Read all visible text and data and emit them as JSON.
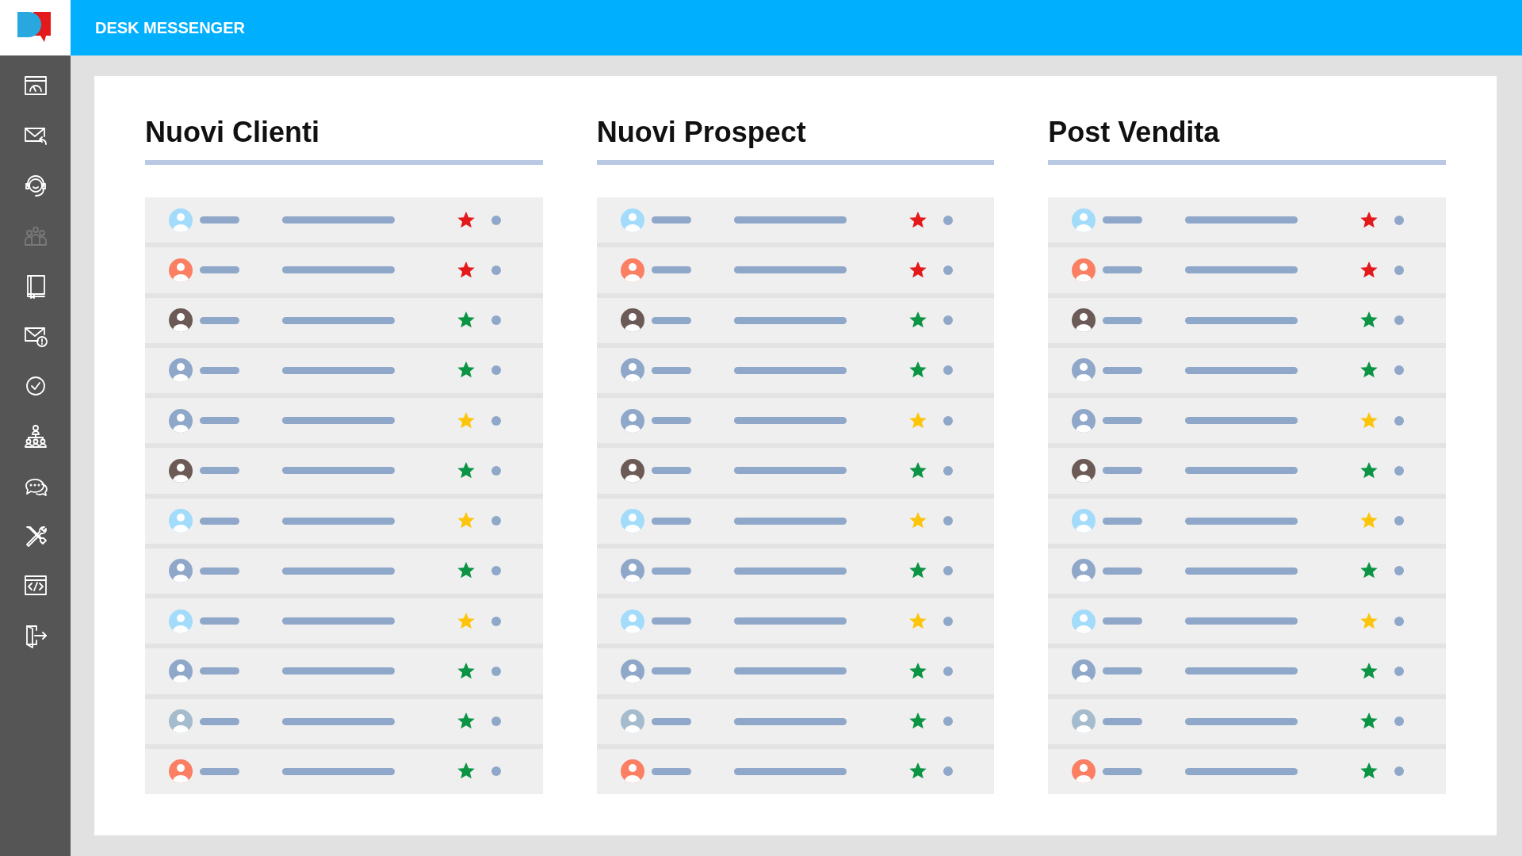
{
  "header": {
    "title": "DESK MESSENGER"
  },
  "sidebar": {
    "items": [
      {
        "kind": "dashboard",
        "disabled": false
      },
      {
        "kind": "mail-reply",
        "disabled": false
      },
      {
        "kind": "support",
        "disabled": false
      },
      {
        "kind": "team",
        "disabled": true
      },
      {
        "kind": "book",
        "disabled": false
      },
      {
        "kind": "mail-alert",
        "disabled": false
      },
      {
        "kind": "check",
        "disabled": false
      },
      {
        "kind": "hierarchy",
        "disabled": false
      },
      {
        "kind": "chat",
        "disabled": false
      },
      {
        "kind": "tools",
        "disabled": false
      },
      {
        "kind": "code",
        "disabled": false
      },
      {
        "kind": "exit",
        "disabled": false
      }
    ]
  },
  "columns": [
    {
      "title": "Nuovi Clienti",
      "rows": [
        {
          "avatar": {
            "color": "#a3dbfb"
          },
          "star": {
            "color": "#e3191b"
          }
        },
        {
          "avatar": {
            "color": "#fb7f62"
          },
          "star": {
            "color": "#e3191b"
          }
        },
        {
          "avatar": {
            "color": "#6b5a55"
          },
          "star": {
            "color": "#0b9444"
          }
        },
        {
          "avatar": {
            "color": "#8fa7c9"
          },
          "star": {
            "color": "#0b9444"
          }
        },
        {
          "avatar": {
            "color": "#8fa7c9"
          },
          "star": {
            "color": "#fcc50c"
          }
        },
        {
          "avatar": {
            "color": "#6b5a55"
          },
          "star": {
            "color": "#0b9444"
          }
        },
        {
          "avatar": {
            "color": "#a3dbfb"
          },
          "star": {
            "color": "#fcc50c"
          }
        },
        {
          "avatar": {
            "color": "#8fa7c9"
          },
          "star": {
            "color": "#0b9444"
          }
        },
        {
          "avatar": {
            "color": "#a3dbfb"
          },
          "star": {
            "color": "#fcc50c"
          }
        },
        {
          "avatar": {
            "color": "#8fa7c9"
          },
          "star": {
            "color": "#0b9444"
          }
        },
        {
          "avatar": {
            "color": "#a4bccd"
          },
          "star": {
            "color": "#0b9444"
          }
        },
        {
          "avatar": {
            "color": "#fb7f62"
          },
          "star": {
            "color": "#0b9444"
          }
        }
      ]
    },
    {
      "title": "Nuovi Prospect",
      "rows": [
        {
          "avatar": {
            "color": "#a3dbfb"
          },
          "star": {
            "color": "#e3191b"
          }
        },
        {
          "avatar": {
            "color": "#fb7f62"
          },
          "star": {
            "color": "#e3191b"
          }
        },
        {
          "avatar": {
            "color": "#6b5a55"
          },
          "star": {
            "color": "#0b9444"
          }
        },
        {
          "avatar": {
            "color": "#8fa7c9"
          },
          "star": {
            "color": "#0b9444"
          }
        },
        {
          "avatar": {
            "color": "#8fa7c9"
          },
          "star": {
            "color": "#fcc50c"
          }
        },
        {
          "avatar": {
            "color": "#6b5a55"
          },
          "star": {
            "color": "#0b9444"
          }
        },
        {
          "avatar": {
            "color": "#a3dbfb"
          },
          "star": {
            "color": "#fcc50c"
          }
        },
        {
          "avatar": {
            "color": "#8fa7c9"
          },
          "star": {
            "color": "#0b9444"
          }
        },
        {
          "avatar": {
            "color": "#a3dbfb"
          },
          "star": {
            "color": "#fcc50c"
          }
        },
        {
          "avatar": {
            "color": "#8fa7c9"
          },
          "star": {
            "color": "#0b9444"
          }
        },
        {
          "avatar": {
            "color": "#a4bccd"
          },
          "star": {
            "color": "#0b9444"
          }
        },
        {
          "avatar": {
            "color": "#fb7f62"
          },
          "star": {
            "color": "#0b9444"
          }
        }
      ]
    },
    {
      "title": "Post Vendita",
      "rows": [
        {
          "avatar": {
            "color": "#a3dbfb"
          },
          "star": {
            "color": "#e3191b"
          }
        },
        {
          "avatar": {
            "color": "#fb7f62"
          },
          "star": {
            "color": "#e3191b"
          }
        },
        {
          "avatar": {
            "color": "#6b5a55"
          },
          "star": {
            "color": "#0b9444"
          }
        },
        {
          "avatar": {
            "color": "#8fa7c9"
          },
          "star": {
            "color": "#0b9444"
          }
        },
        {
          "avatar": {
            "color": "#8fa7c9"
          },
          "star": {
            "color": "#fcc50c"
          }
        },
        {
          "avatar": {
            "color": "#6b5a55"
          },
          "star": {
            "color": "#0b9444"
          }
        },
        {
          "avatar": {
            "color": "#a3dbfb"
          },
          "star": {
            "color": "#fcc50c"
          }
        },
        {
          "avatar": {
            "color": "#8fa7c9"
          },
          "star": {
            "color": "#0b9444"
          }
        },
        {
          "avatar": {
            "color": "#a3dbfb"
          },
          "star": {
            "color": "#fcc50c"
          }
        },
        {
          "avatar": {
            "color": "#8fa7c9"
          },
          "star": {
            "color": "#0b9444"
          }
        },
        {
          "avatar": {
            "color": "#a4bccd"
          },
          "star": {
            "color": "#0b9444"
          }
        },
        {
          "avatar": {
            "color": "#fb7f62"
          },
          "star": {
            "color": "#0b9444"
          }
        }
      ]
    }
  ]
}
